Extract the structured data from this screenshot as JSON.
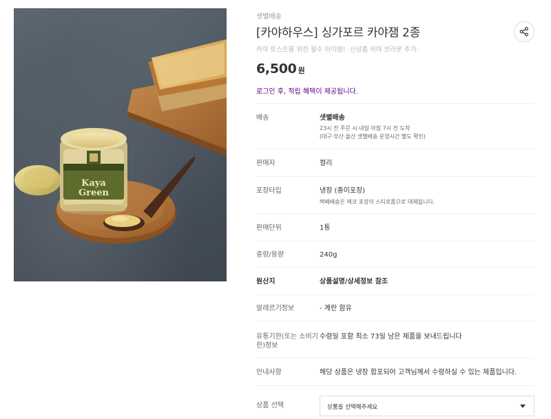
{
  "product": {
    "delivery_badge": "샛별배송",
    "title": "[카야하우스] 싱가포르 카야잼 2종",
    "subtitle": "카야 토스트를 위한 필수 아이템! -신상품 카야 브라운 추가-",
    "price": "6,500",
    "price_unit": "원",
    "login_benefit": "로그인 후, 적립 혜택이 제공됩니다.",
    "jar_label_line1": "Kaya",
    "jar_label_line2": "Green"
  },
  "specs": {
    "delivery": {
      "label": "배송",
      "value": "샛별배송",
      "note1": "23시 전 주문 시 내일 아침 7시 전 도착",
      "note2": "(대구·부산·울산 샛별배송 운영시간 별도 확인)"
    },
    "seller": {
      "label": "판매자",
      "value": "컬리"
    },
    "packaging": {
      "label": "포장타입",
      "value": "냉장 (종이포장)",
      "note": "택배배송은 에코 포장이 스티로폼으로 대체됩니다."
    },
    "unit": {
      "label": "판매단위",
      "value": "1통"
    },
    "weight": {
      "label": "중량/용량",
      "value": "240g"
    },
    "origin": {
      "label": "원산지",
      "value": "상품설명/상세정보 참조"
    },
    "allergy": {
      "label": "알레르기정보",
      "value": "- 계란 함유"
    },
    "expiry": {
      "label_line1": "유통기한(또는 소비기",
      "label_line2": "한)정보",
      "value": "수령일 포함 최소 73일 남은 제품을 보내드립니다"
    },
    "notice": {
      "label": "안내사항",
      "value": "해당 상품은 냉장 합포되어 고객님께서 수령하실 수 있는 제품입니다."
    },
    "option": {
      "label": "상품 선택",
      "placeholder": "상품을 선택해주세요"
    }
  },
  "colors": {
    "accent": "#5f0080",
    "border": "#f0f0f0"
  },
  "icons": {
    "share": "share-icon",
    "select_caret": "caret-down-icon"
  }
}
